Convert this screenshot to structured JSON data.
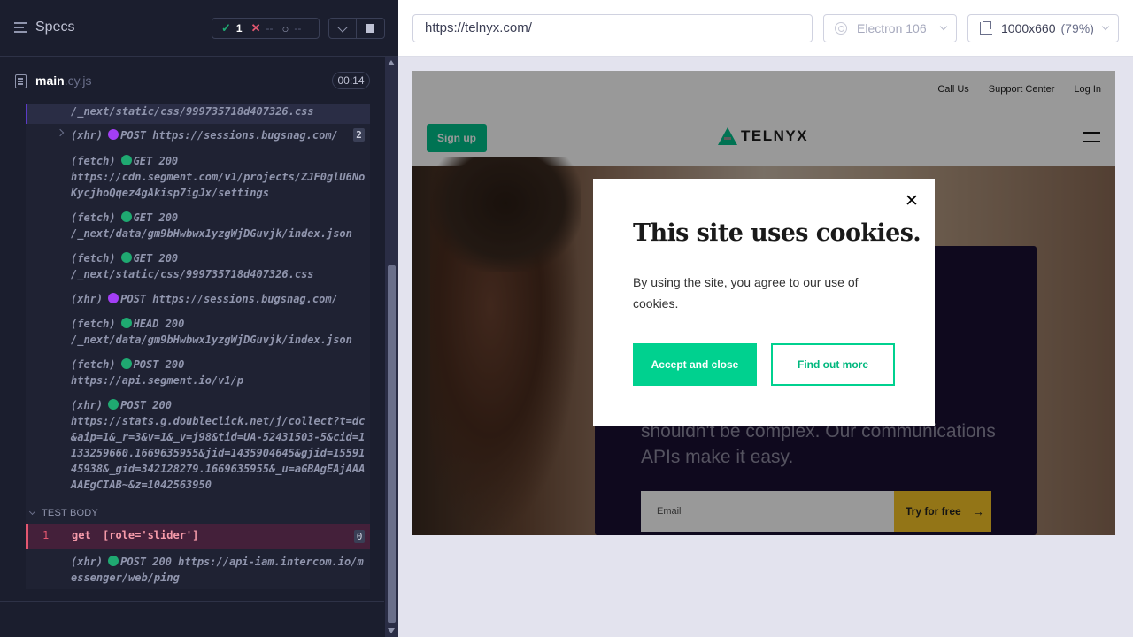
{
  "runner": {
    "specs_label": "Specs",
    "stats": {
      "passed": "1",
      "failed": "--",
      "pending": "--"
    },
    "file": {
      "name": "main",
      "ext": ".cy.js",
      "duration": "00:14"
    },
    "log": [
      {
        "type": "",
        "dot": "",
        "method": "",
        "text": "/_next/static/css/999735718d407326.css"
      },
      {
        "type": "(xhr)",
        "dot": "xhr",
        "method": "POST",
        "text": "https://sessions.bugsnag.com/",
        "count": "2"
      },
      {
        "type": "(fetch)",
        "dot": "ok",
        "method": "GET 200",
        "text": "https://cdn.segment.com/v1/projects/ZJF0glU6NoKycjhoQqez4gAkisp7igJx/settings"
      },
      {
        "type": "(fetch)",
        "dot": "ok",
        "method": "GET 200",
        "text": "/_next/data/gm9bHwbwx1yzgWjDGuvjk/index.json"
      },
      {
        "type": "(fetch)",
        "dot": "ok",
        "method": "GET 200",
        "text": "/_next/static/css/999735718d407326.css"
      },
      {
        "type": "(xhr)",
        "dot": "xhr",
        "method": "POST",
        "text": "https://sessions.bugsnag.com/"
      },
      {
        "type": "(fetch)",
        "dot": "ok",
        "method": "HEAD 200",
        "text": "/_next/data/gm9bHwbwx1yzgWjDGuvjk/index.json"
      },
      {
        "type": "(fetch)",
        "dot": "ok",
        "method": "POST 200",
        "text": "https://api.segment.io/v1/p"
      },
      {
        "type": "(xhr)",
        "dot": "ok",
        "method": "POST 200",
        "text": "https://stats.g.doubleclick.net/j/collect?t=dc&aip=1&_r=3&v=1&_v=j98&tid=UA-52431503-5&cid=1133259660.1669635955&jid=1435904645&gjid=1559145938&_gid=342128279.1669635955&_u=aGBAgEAjAAAAAEgCIAB~&z=1042563950"
      }
    ],
    "test_body_label": "TEST BODY",
    "failed_cmd": {
      "num": "1",
      "name": "get",
      "selector": "[role='slider']",
      "count": "0"
    },
    "last_log": {
      "type": "(xhr)",
      "dot": "ok",
      "method": "POST 200",
      "text": "https://api-iam.intercom.io/messenger/web/ping"
    }
  },
  "browser": {
    "url": "https://telnyx.com/",
    "browser_name": "Electron 106",
    "viewport": "1000x660",
    "zoom": "(79%)"
  },
  "site": {
    "links": [
      "Call Us",
      "Support Center",
      "Log In"
    ],
    "signup": "Sign up",
    "logo": "TELNYX",
    "hero_copy": "shouldn't be complex. Our communications APIs make it easy.",
    "email_placeholder": "Email",
    "try_label": "Try for free",
    "try_arrow": "→"
  },
  "cookie_modal": {
    "close": "✕",
    "title": "This site uses cookies.",
    "text": "By using the site, you agree to our use of cookies.",
    "accept": "Accept and close",
    "find_more": "Find out more"
  },
  "colors": {
    "accent": "#00d18f",
    "runner_bg": "#1b1e2e",
    "fail": "#e45770",
    "pass": "#1fa971"
  }
}
